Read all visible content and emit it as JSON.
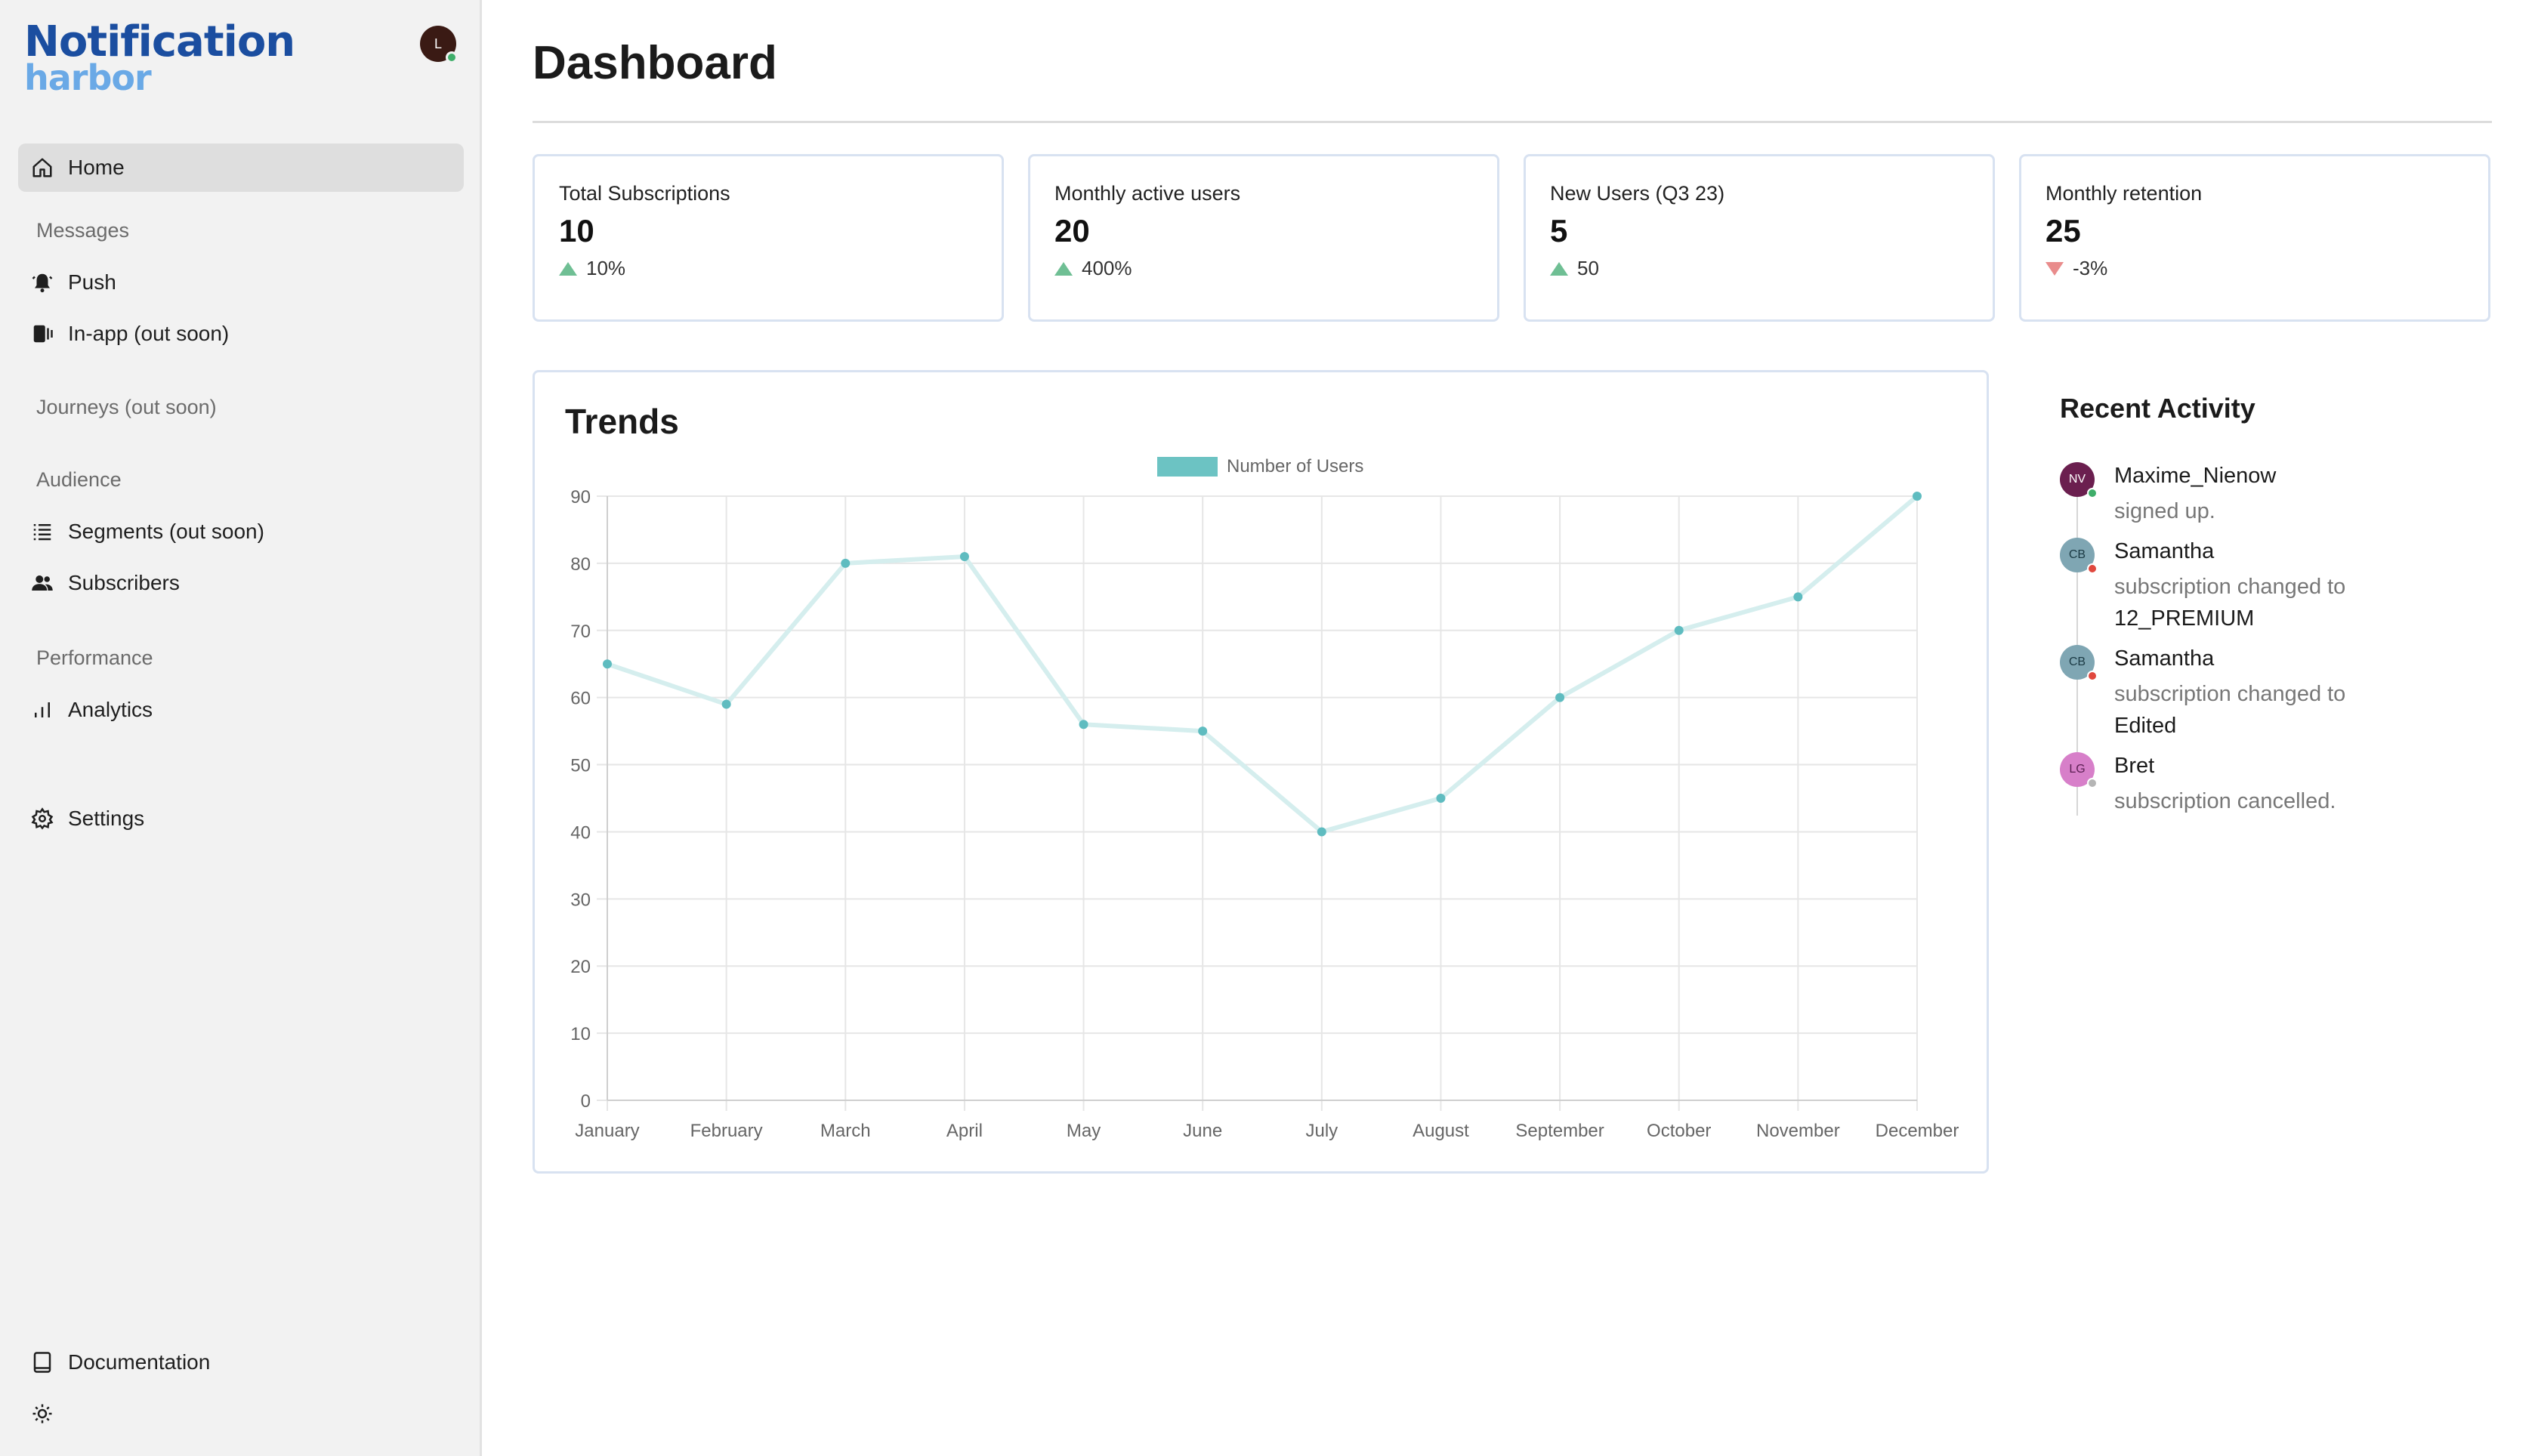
{
  "sidebar": {
    "logo_top": "Notification",
    "logo_bottom": "harbor",
    "user_initial": "L",
    "items": {
      "home": "Home",
      "messages_section": "Messages",
      "push": "Push",
      "inapp": "In-app (out soon)",
      "journeys": "Journeys (out soon)",
      "audience_section": "Audience",
      "segments": "Segments (out soon)",
      "subscribers": "Subscribers",
      "performance_section": "Performance",
      "analytics": "Analytics",
      "settings": "Settings",
      "documentation": "Documentation"
    },
    "icons": {
      "home": "home-icon",
      "push": "bell-ringing-icon",
      "inapp": "mobile-icon",
      "segments": "list-icon",
      "subscribers": "users-icon",
      "analytics": "bar-chart-icon",
      "settings": "gear-icon",
      "documentation": "book-icon",
      "theme": "sun-icon"
    }
  },
  "main": {
    "title": "Dashboard",
    "stats": [
      {
        "label": "Total Subscriptions",
        "value": "10",
        "change": "10%",
        "direction": "up"
      },
      {
        "label": "Monthly active users",
        "value": "20",
        "change": "400%",
        "direction": "up"
      },
      {
        "label": "New Users (Q3 23)",
        "value": "5",
        "change": "50",
        "direction": "up"
      },
      {
        "label": "Monthly retention",
        "value": "25",
        "change": "-3%",
        "direction": "down"
      }
    ],
    "trends_title": "Trends",
    "activity": {
      "title": "Recent Activity",
      "items": [
        {
          "initials": "NV",
          "name": "Maxime_Nienow",
          "desc": "signed up.",
          "emphasis": "",
          "avatar_color": "#6b1f4f",
          "status_color": "#3fae6a"
        },
        {
          "initials": "CB",
          "name": "Samantha",
          "desc": "subscription changed to",
          "emphasis": "12_PREMIUM",
          "avatar_color": "#7fa6b3",
          "status_color": "#e0483e"
        },
        {
          "initials": "CB",
          "name": "Samantha",
          "desc": "subscription changed to",
          "emphasis": "Edited",
          "avatar_color": "#7fa6b3",
          "status_color": "#e0483e"
        },
        {
          "initials": "LG",
          "name": "Bret",
          "desc": "subscription cancelled.",
          "emphasis": "",
          "avatar_color": "#d77fc9",
          "status_color": "#b5b5b5"
        }
      ]
    }
  },
  "chart_data": {
    "type": "line",
    "categories": [
      "January",
      "February",
      "March",
      "April",
      "May",
      "June",
      "July",
      "August",
      "September",
      "October",
      "November",
      "December"
    ],
    "series": [
      {
        "name": "Number of Users",
        "values": [
          65,
          59,
          80,
          81,
          56,
          55,
          40,
          45,
          60,
          70,
          75,
          90
        ]
      }
    ],
    "ylim": [
      0,
      90
    ],
    "yticks": [
      0,
      10,
      20,
      30,
      40,
      50,
      60,
      70,
      80,
      90
    ],
    "grid": true,
    "legend": "top-center",
    "colors": {
      "line": "#d5eeee",
      "point": "#5fbcc0",
      "legend": "#6cc3c3"
    }
  }
}
